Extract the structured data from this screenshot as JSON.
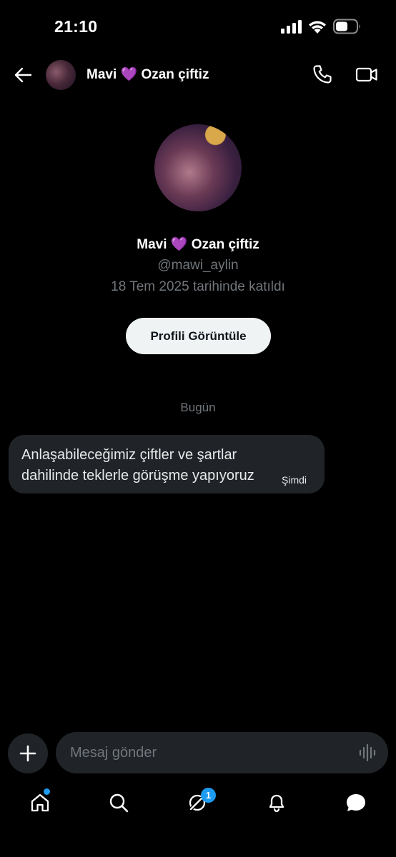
{
  "status_bar": {
    "time": "21:10"
  },
  "header": {
    "name": "Mavi 💜 Ozan çiftiz"
  },
  "profile": {
    "name": "Mavi 💜 Ozan çiftiz",
    "handle": "@mawi_aylin",
    "joined": "18 Tem 2025 tarihinde katıldı",
    "view_profile_label": "Profili Görüntüle"
  },
  "conversation": {
    "date_divider": "Bugün",
    "messages": [
      {
        "text": "Anlaşabileceğimiz çiftler ve şartlar dahilinde teklerle görüşme yapıyoruz",
        "time": "Şimdi"
      }
    ]
  },
  "composer": {
    "placeholder": "Mesaj gönder",
    "value": ""
  },
  "bottom_nav": {
    "items": [
      {
        "icon": "home-icon",
        "has_dot": true
      },
      {
        "icon": "search-icon"
      },
      {
        "icon": "grok-icon",
        "badge": "1"
      },
      {
        "icon": "bell-icon"
      },
      {
        "icon": "messages-icon",
        "active": true
      }
    ],
    "accent": "#1d9bf0"
  }
}
